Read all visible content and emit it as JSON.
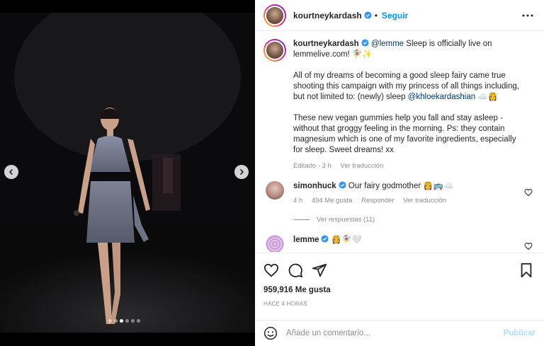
{
  "post": {
    "dots_total": 6,
    "dots_active_index": 2
  },
  "header": {
    "username": "kourtneykardash",
    "separator": "•",
    "follow_label": "Seguir"
  },
  "caption": {
    "username": "kourtneykardash",
    "mention_1": "@lemme",
    "line_1_rest": " Sleep is officially live on lemmelive.com! 🧚‍♀️✨",
    "para_2_start": "All of my dreams of becoming a good sleep fairy came true shooting this campaign with my princess of all things including, but not limited to: (newly) sleep ",
    "mention_2": "@khloekardashian",
    "para_2_end": " ☁️👸",
    "para_3": "These new vegan gummies help you fall and stay asleep - without that groggy feeling in the morning. Ps: they contain magnesium which is one of my favorite ingredients, especially for sleep. Sweet dreams! xx",
    "edited": "Editado · 3 h",
    "see_translation": "Ver traducción"
  },
  "comments": [
    {
      "username": "simonhuck",
      "text": " Our fairy godmother 👸🚌☁️",
      "time": "4 h",
      "likes": "494 Me gusta",
      "reply": "Responder",
      "translate": "Ver traducción",
      "view_replies": "Ver respuestas (11)"
    },
    {
      "username": "lemme",
      "text": " 👸🧚‍♀️🤍"
    }
  ],
  "actions": {
    "likes": "959,916 Me gusta",
    "time_ago": "HACE 4 HORAS"
  },
  "composer": {
    "placeholder": "Añade un comentario...",
    "publish_label": "Publicar"
  },
  "colors": {
    "accent": "#0095f6",
    "publish_disabled": "#b2dffc",
    "mention": "#00376b",
    "muted": "#8e8e8e"
  },
  "icons": {
    "like": "heart-icon",
    "comment": "comment-icon",
    "share": "paper-plane-icon",
    "save": "bookmark-icon",
    "emoji": "smiley-icon",
    "more": "more-horizontal-icon",
    "verified": "verified-badge-icon"
  }
}
